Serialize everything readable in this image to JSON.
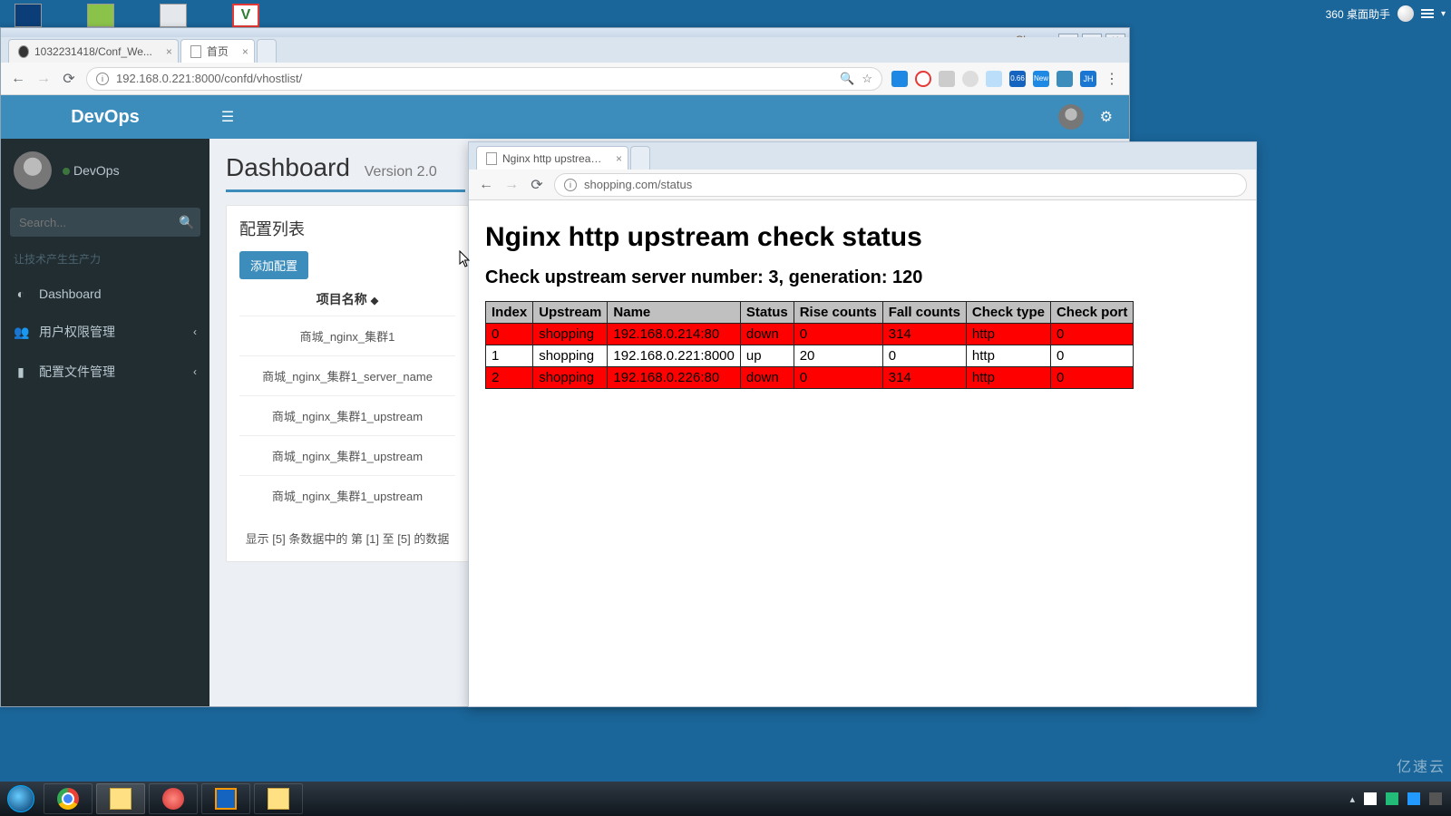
{
  "desktop": {
    "helper": "360 桌面助手"
  },
  "chromeMain": {
    "userChip": "Cheng",
    "tabs": [
      {
        "icon": "github",
        "label": "1032231418/Conf_We..."
      },
      {
        "icon": "page",
        "label": "首页"
      }
    ],
    "url": "192.168.0.221:8000/confd/vhostlist/"
  },
  "app": {
    "logo": "DevOps",
    "user": "DevOps",
    "searchPlaceholder": "Search...",
    "tagline": "让技术产生生产力",
    "nav": [
      {
        "icon": "dashboard",
        "label": "Dashboard",
        "expandable": false
      },
      {
        "icon": "users",
        "label": "用户权限管理",
        "expandable": true
      },
      {
        "icon": "folder",
        "label": "配置文件管理",
        "expandable": true
      }
    ],
    "pageTitle": "Dashboard",
    "pageSub": "Version 2.0",
    "panelTitle": "配置列表",
    "addBtn": "添加配置",
    "colHeader": "项目名称",
    "rows": [
      "商城_nginx_集群1",
      "商城_nginx_集群1_server_name",
      "商城_nginx_集群1_upstream",
      "商城_nginx_集群1_upstream",
      "商城_nginx_集群1_upstream"
    ],
    "pager": "显示 [5] 条数据中的 第 [1] 至 [5] 的数据"
  },
  "chrome2": {
    "tabLabel": "Nginx http upstream ch",
    "url": "shopping.com/status",
    "h1": "Nginx http upstream check status",
    "h2": "Check upstream server number: 3, generation: 120",
    "headers": [
      "Index",
      "Upstream",
      "Name",
      "Status",
      "Rise counts",
      "Fall counts",
      "Check type",
      "Check port"
    ],
    "rows": [
      {
        "status": "down",
        "cells": [
          "0",
          "shopping",
          "192.168.0.214:80",
          "down",
          "0",
          "314",
          "http",
          "0"
        ]
      },
      {
        "status": "up",
        "cells": [
          "1",
          "shopping",
          "192.168.0.221:8000",
          "up",
          "20",
          "0",
          "http",
          "0"
        ]
      },
      {
        "status": "down",
        "cells": [
          "2",
          "shopping",
          "192.168.0.226:80",
          "down",
          "0",
          "314",
          "http",
          "0"
        ]
      }
    ]
  },
  "watermark": "亿速云",
  "chart_data": {
    "type": "table",
    "title": "Nginx http upstream check status",
    "columns": [
      "Index",
      "Upstream",
      "Name",
      "Status",
      "Rise counts",
      "Fall counts",
      "Check type",
      "Check port"
    ],
    "rows": [
      [
        0,
        "shopping",
        "192.168.0.214:80",
        "down",
        0,
        314,
        "http",
        0
      ],
      [
        1,
        "shopping",
        "192.168.0.221:8000",
        "up",
        20,
        0,
        "http",
        0
      ],
      [
        2,
        "shopping",
        "192.168.0.226:80",
        "down",
        0,
        314,
        "http",
        0
      ]
    ],
    "summary": {
      "server_number": 3,
      "generation": 120
    }
  }
}
